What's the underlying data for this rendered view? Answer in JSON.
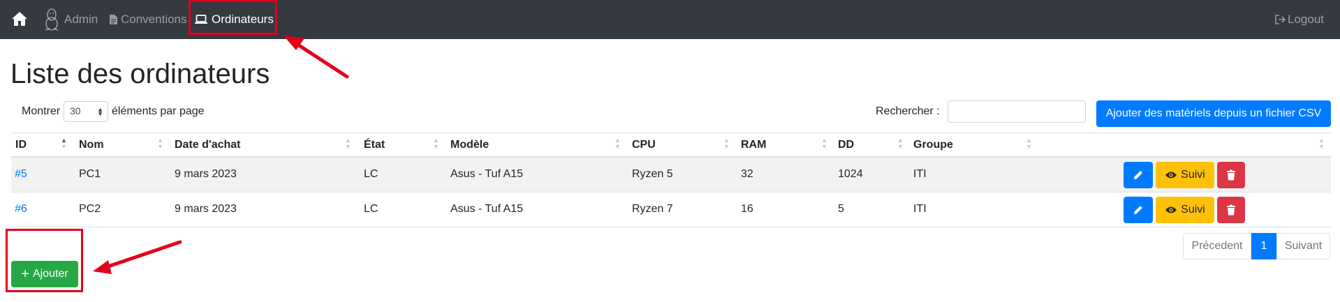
{
  "navbar": {
    "admin_label": "Admin",
    "conventions_label": "Conventions",
    "ordinateurs_label": "Ordinateurs",
    "logout_label": "Logout"
  },
  "page": {
    "title": "Liste des ordinateurs"
  },
  "controls": {
    "show_label": "Montrer",
    "page_length": "30",
    "per_page_label": "éléments par page",
    "search_label": "Rechercher :",
    "search_value": "",
    "csv_button_label": "Ajouter des matériels depuis un fichier CSV"
  },
  "table": {
    "headers": [
      "ID",
      "Nom",
      "Date d'achat",
      "État",
      "Modèle",
      "CPU",
      "RAM",
      "DD",
      "Groupe"
    ],
    "sorted_column": "ID",
    "rows": [
      {
        "id": "#5",
        "nom": "PC1",
        "date": "9 mars 2023",
        "etat": "LC",
        "modele": "Asus - Tuf A15",
        "cpu": "Ryzen 5",
        "ram": "32",
        "dd": "1024",
        "groupe": "ITI",
        "suivi_label": "Suivi"
      },
      {
        "id": "#6",
        "nom": "PC2",
        "date": "9 mars 2023",
        "etat": "LC",
        "modele": "Asus - Tuf A15",
        "cpu": "Ryzen 7",
        "ram": "16",
        "dd": "5",
        "groupe": "ITI",
        "suivi_label": "Suivi"
      }
    ]
  },
  "pagination": {
    "prev_label": "Précedent",
    "current_page": "1",
    "next_label": "Suivant"
  },
  "actions": {
    "add_label": "Ajouter"
  },
  "icons": {
    "home": "home-icon",
    "admin": "linux-penguin-icon",
    "conventions": "file-icon",
    "ordinateurs": "laptop-icon",
    "logout": "sign-out-icon",
    "edit": "pencil-icon",
    "suivi": "eye-icon",
    "delete": "trash-icon",
    "add": "plus-icon"
  },
  "colors": {
    "navbar": "#343a40",
    "primary": "#007bff",
    "warning": "#ffc107",
    "danger": "#dc3545",
    "success": "#28a745",
    "annotation": "#e3001b"
  }
}
